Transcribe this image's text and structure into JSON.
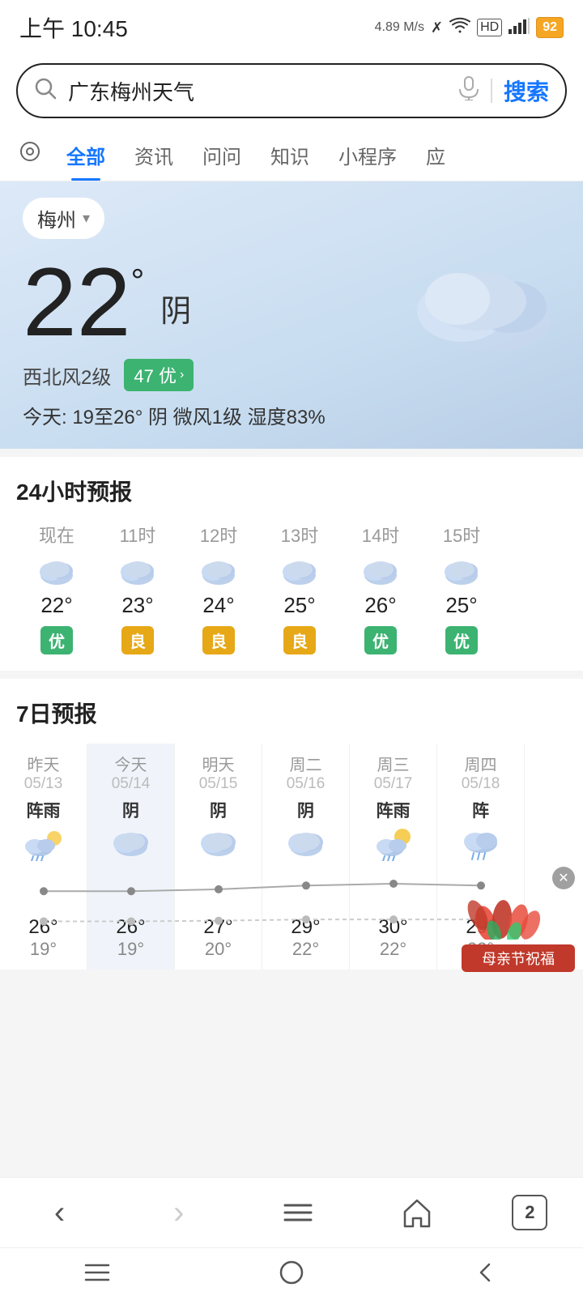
{
  "statusBar": {
    "time": "上午 10:45",
    "speed": "4.89 M/s",
    "battery": "92"
  },
  "searchBar": {
    "query": "广东梅州天气",
    "btnLabel": "搜索"
  },
  "tabs": [
    {
      "label": "全部",
      "active": true
    },
    {
      "label": "资讯",
      "active": false
    },
    {
      "label": "问问",
      "active": false
    },
    {
      "label": "知识",
      "active": false
    },
    {
      "label": "小程序",
      "active": false
    },
    {
      "label": "应",
      "active": false
    }
  ],
  "weather": {
    "city": "梅州",
    "temp": "22",
    "desc": "阴",
    "wind": "西北风2级",
    "aqi": "47 优",
    "todayRange": "今天: 19至26°  阴  微风1级  湿度83%"
  },
  "hourly": {
    "title": "24小时预报",
    "items": [
      {
        "label": "现在",
        "temp": "22°",
        "aqi": "优",
        "aqiClass": "aqi-green"
      },
      {
        "label": "11时",
        "temp": "23°",
        "aqi": "良",
        "aqiClass": "aqi-yellow"
      },
      {
        "label": "12时",
        "temp": "24°",
        "aqi": "良",
        "aqiClass": "aqi-yellow"
      },
      {
        "label": "13时",
        "temp": "25°",
        "aqi": "良",
        "aqiClass": "aqi-yellow"
      },
      {
        "label": "14时",
        "temp": "26°",
        "aqi": "优",
        "aqiClass": "aqi-green"
      },
      {
        "label": "15时",
        "temp": "25°",
        "aqi": "优",
        "aqiClass": "aqi-green"
      }
    ]
  },
  "weekly": {
    "title": "7日预报",
    "days": [
      {
        "name": "昨天",
        "date": "05/13",
        "weather": "阵雨",
        "high": "26°",
        "low": "19°",
        "isToday": false
      },
      {
        "name": "今天",
        "date": "05/14",
        "weather": "阴",
        "high": "26°",
        "low": "19°",
        "isToday": true
      },
      {
        "name": "明天",
        "date": "05/15",
        "weather": "阴",
        "high": "27°",
        "low": "20°",
        "isToday": false
      },
      {
        "name": "周二",
        "date": "05/16",
        "weather": "阴",
        "high": "29°",
        "low": "22°",
        "isToday": false
      },
      {
        "name": "周三",
        "date": "05/17",
        "weather": "阵雨",
        "high": "30°",
        "low": "22°",
        "isToday": false
      },
      {
        "name": "周四",
        "date": "05/18",
        "weather": "阵",
        "high": "29°",
        "low": "22°",
        "isToday": false
      }
    ]
  },
  "floatPromo": {
    "label": "母亲节祝福"
  },
  "bottomNav": {
    "back": "‹",
    "forward": "›",
    "menu": "☰",
    "home": "⌂",
    "tabs": "2"
  },
  "systemBar": {
    "menu": "☰",
    "home": "○",
    "back": "◁"
  }
}
